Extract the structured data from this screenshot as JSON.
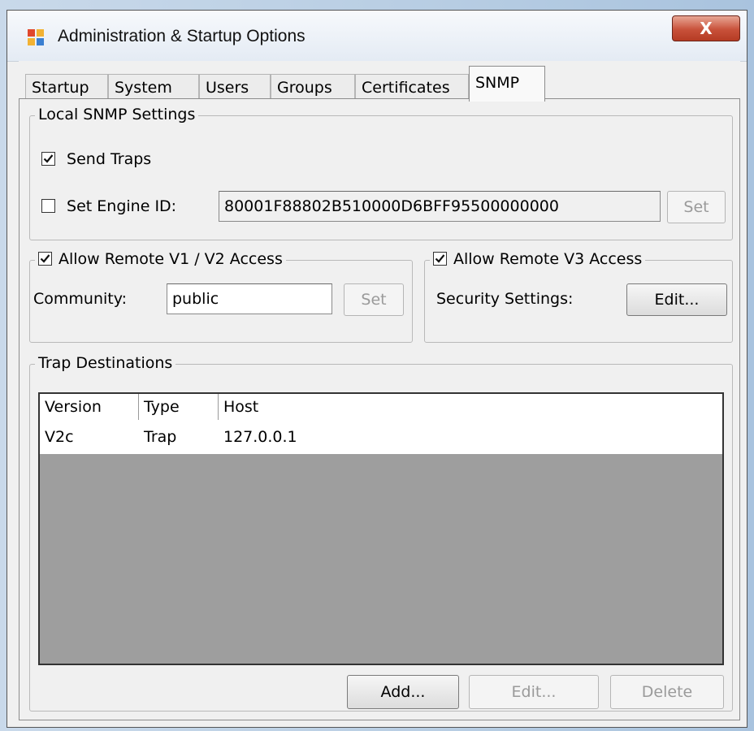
{
  "window": {
    "title": "Administration & Startup Options",
    "close_glyph": "X"
  },
  "tabs": [
    {
      "label": "Startup"
    },
    {
      "label": "System"
    },
    {
      "label": "Users"
    },
    {
      "label": "Groups"
    },
    {
      "label": "Certificates"
    },
    {
      "label": "SNMP",
      "active": true
    }
  ],
  "local_snmp": {
    "legend": "Local SNMP Settings",
    "send_traps": {
      "label": "Send Traps",
      "checked": true
    },
    "engine_id": {
      "label": "Set Engine ID:",
      "checked": false,
      "value": "80001F88802B510000D6BFF95500000000"
    },
    "set_button": "Set"
  },
  "remote_v1v2": {
    "legend": "Allow Remote V1 / V2 Access",
    "checked": true,
    "community_label": "Community:",
    "community_value": "public",
    "set_button": "Set"
  },
  "remote_v3": {
    "legend": "Allow Remote V3 Access",
    "checked": true,
    "security_label": "Security Settings:",
    "edit_button": "Edit..."
  },
  "trap_destinations": {
    "legend": "Trap Destinations",
    "columns": [
      "Version",
      "Type",
      "Host"
    ],
    "rows": [
      {
        "version": "V2c",
        "type": "Trap",
        "host": "127.0.0.1"
      }
    ],
    "buttons": {
      "add": "Add...",
      "edit": "Edit...",
      "delete": "Delete"
    }
  }
}
